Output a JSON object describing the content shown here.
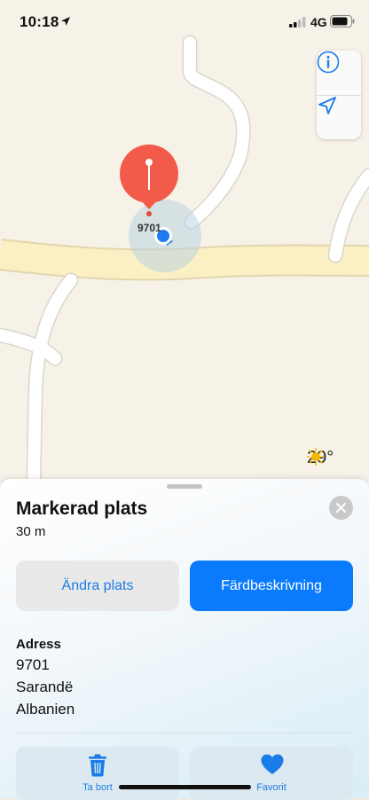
{
  "status_bar": {
    "time": "10:18",
    "network": "4G"
  },
  "map": {
    "pin_label": "9701",
    "weather_temp": "29°"
  },
  "sheet": {
    "title": "Markerad plats",
    "distance": "30 m",
    "edit_button": "Ändra plats",
    "directions_button": "Färdbeskrivning",
    "address_heading": "Adress",
    "address_lines": [
      "9701",
      "Sarandë",
      "Albanien"
    ],
    "actions": {
      "delete": "Ta bort",
      "favorite": "Favorit"
    }
  },
  "icons": {
    "location-services": "location-arrow-icon",
    "info": "info-icon",
    "tracking": "navigation-arrow-icon",
    "weather": "sun-icon",
    "close": "close-icon",
    "delete": "trash-icon",
    "favorite": "heart-icon"
  },
  "colors": {
    "accent": "#0a7bfc",
    "pin": "#f25a4a",
    "user_location": "#1e7cf0"
  }
}
